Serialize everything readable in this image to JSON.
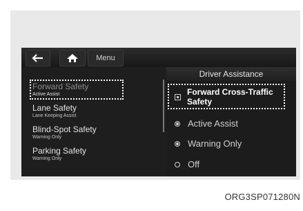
{
  "topbar": {
    "back_icon": "back-arrow-icon",
    "home_icon": "home-icon",
    "menu_label": "Menu"
  },
  "left_menu": {
    "items": [
      {
        "title": "Forward Safety",
        "sub": "Active Assist",
        "selected": true
      },
      {
        "title": "Lane Safety",
        "sub": "Lane Keeping Assist"
      },
      {
        "title": "Blind-Spot Safety",
        "sub": "Warning Only"
      },
      {
        "title": "Parking Safety",
        "sub": "Warning Only"
      }
    ]
  },
  "right_panel": {
    "header": "Driver Assistance",
    "checkbox_title": "Forward Cross-Traffic Safety",
    "options": [
      {
        "label": "Active Assist",
        "selected": true
      },
      {
        "label": "Warning Only",
        "selected": true
      },
      {
        "label": "Off",
        "selected": false
      }
    ]
  },
  "caption": "ORG3SP071280N"
}
